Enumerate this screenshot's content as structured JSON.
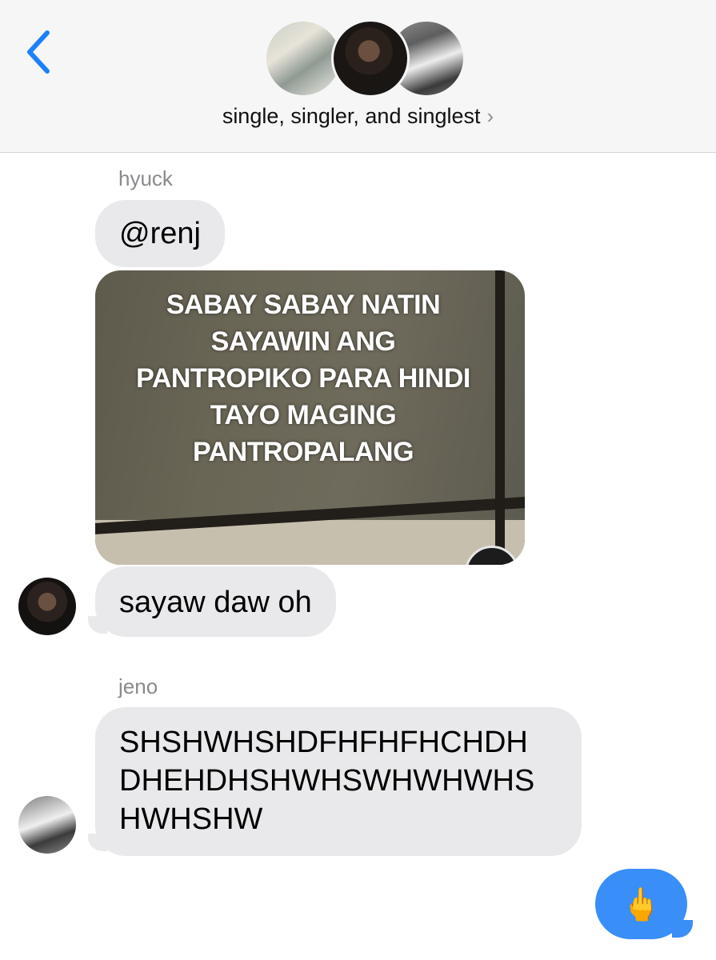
{
  "header": {
    "group_name": "single, singler, and singlest",
    "chevron": "›"
  },
  "icons": {
    "back": "chevron-left-icon",
    "disclosure": "chevron-right-icon"
  },
  "colors": {
    "accent": "#1a82fb",
    "incoming_bubble": "#e9e9eb",
    "outgoing_bubble": "#3a8ef7",
    "header_bg": "#f6f6f6"
  },
  "messages": [
    {
      "sender": "hyuck",
      "text": "@renj"
    },
    {
      "sender": "hyuck",
      "media_caption": "SABAY SABAY NATIN SAYAWIN ANG PANTROPIKO PARA HINDI TAYO MAGING PANTROPALANG"
    },
    {
      "sender": "hyuck",
      "text": "sayaw daw oh"
    },
    {
      "sender": "jeno",
      "text": "SHSHWHSHDFHFHFHCHDH DHEHDHSHWHSWHWHWHS HWHSHW"
    },
    {
      "sender": "me",
      "text": "🖕"
    }
  ]
}
